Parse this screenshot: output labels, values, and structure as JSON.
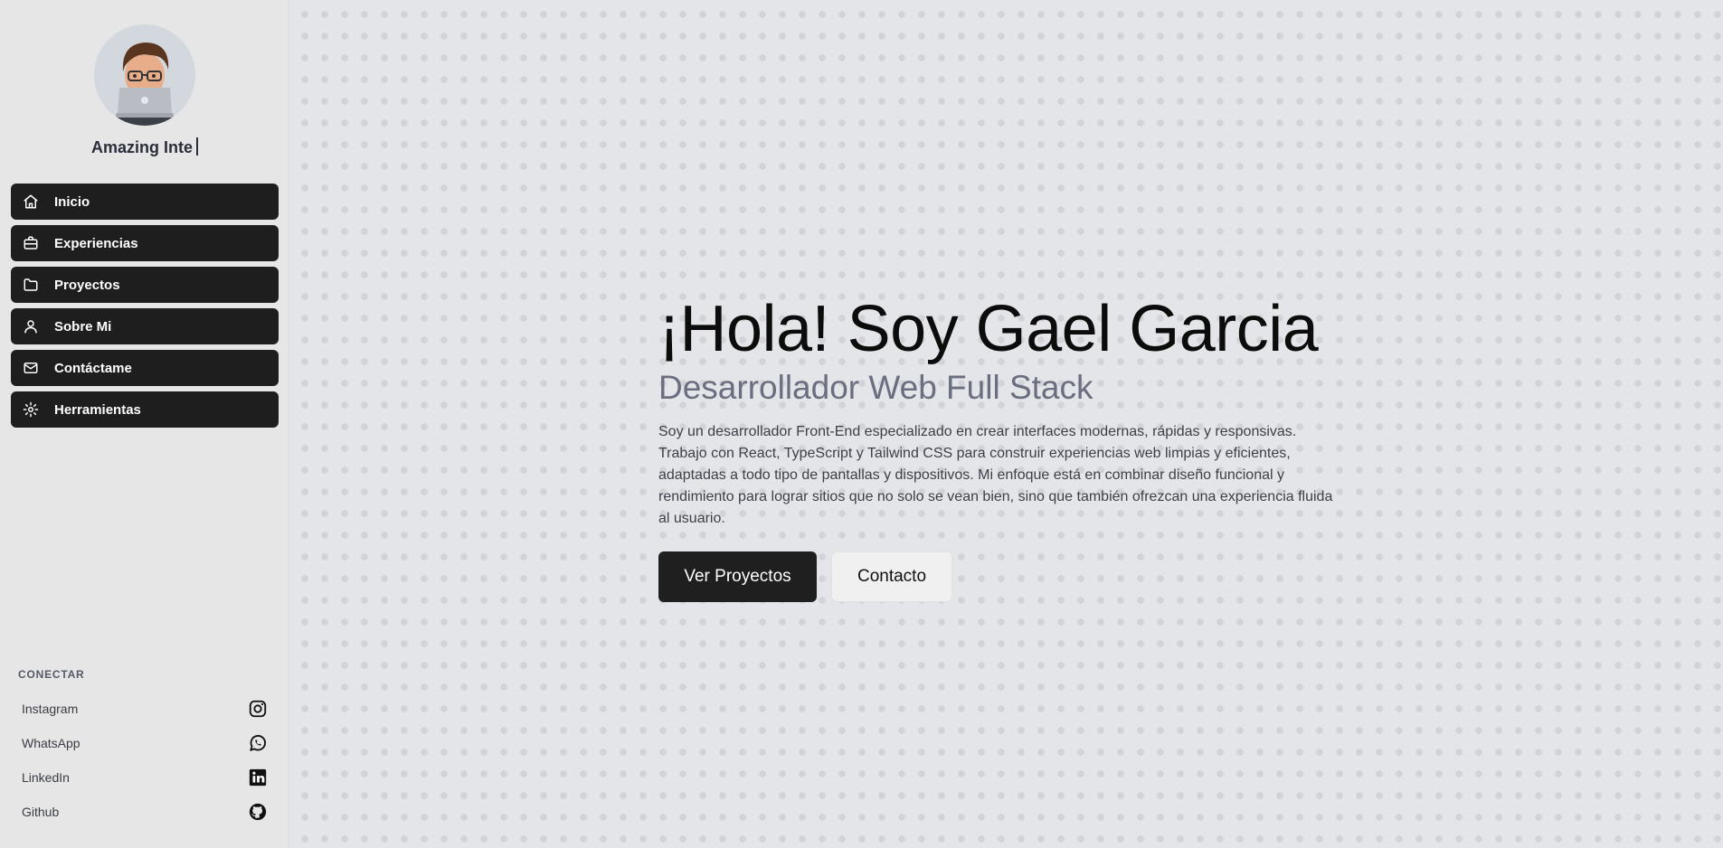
{
  "sidebar": {
    "typing_text": "Amazing Inte",
    "nav": [
      {
        "label": "Inicio",
        "icon": "home-icon"
      },
      {
        "label": "Experiencias",
        "icon": "briefcase-icon"
      },
      {
        "label": "Proyectos",
        "icon": "folder-icon"
      },
      {
        "label": "Sobre Mi",
        "icon": "user-icon"
      },
      {
        "label": "Contáctame",
        "icon": "mail-icon"
      },
      {
        "label": "Herramientas",
        "icon": "gear-icon"
      }
    ],
    "connect_title": "CONECTAR",
    "social": [
      {
        "label": "Instagram",
        "icon": "instagram-icon"
      },
      {
        "label": "WhatsApp",
        "icon": "whatsapp-icon"
      },
      {
        "label": "LinkedIn",
        "icon": "linkedin-icon"
      },
      {
        "label": "Github",
        "icon": "github-icon"
      }
    ]
  },
  "hero": {
    "title": "¡Hola! Soy Gael Garcia",
    "subtitle": "Desarrollador Web Full Stack",
    "description": "Soy un desarrollador Front-End especializado en crear interfaces modernas, rápidas y responsivas. Trabajo con React, TypeScript y Tailwind CSS para construir experiencias web limpias y eficientes, adaptadas a todo tipo de pantallas y dispositivos. Mi enfoque está en combinar diseño funcional y rendimiento para lograr sitios que no solo se vean bien, sino que también ofrezcan una experiencia fluida al usuario.",
    "primary_button": "Ver Proyectos",
    "secondary_button": "Contacto"
  },
  "colors": {
    "nav_bg": "#1e1e1e",
    "page_bg": "#e4e5e9",
    "sidebar_bg": "#e6e6e6",
    "subtitle": "#6a6e7e"
  }
}
